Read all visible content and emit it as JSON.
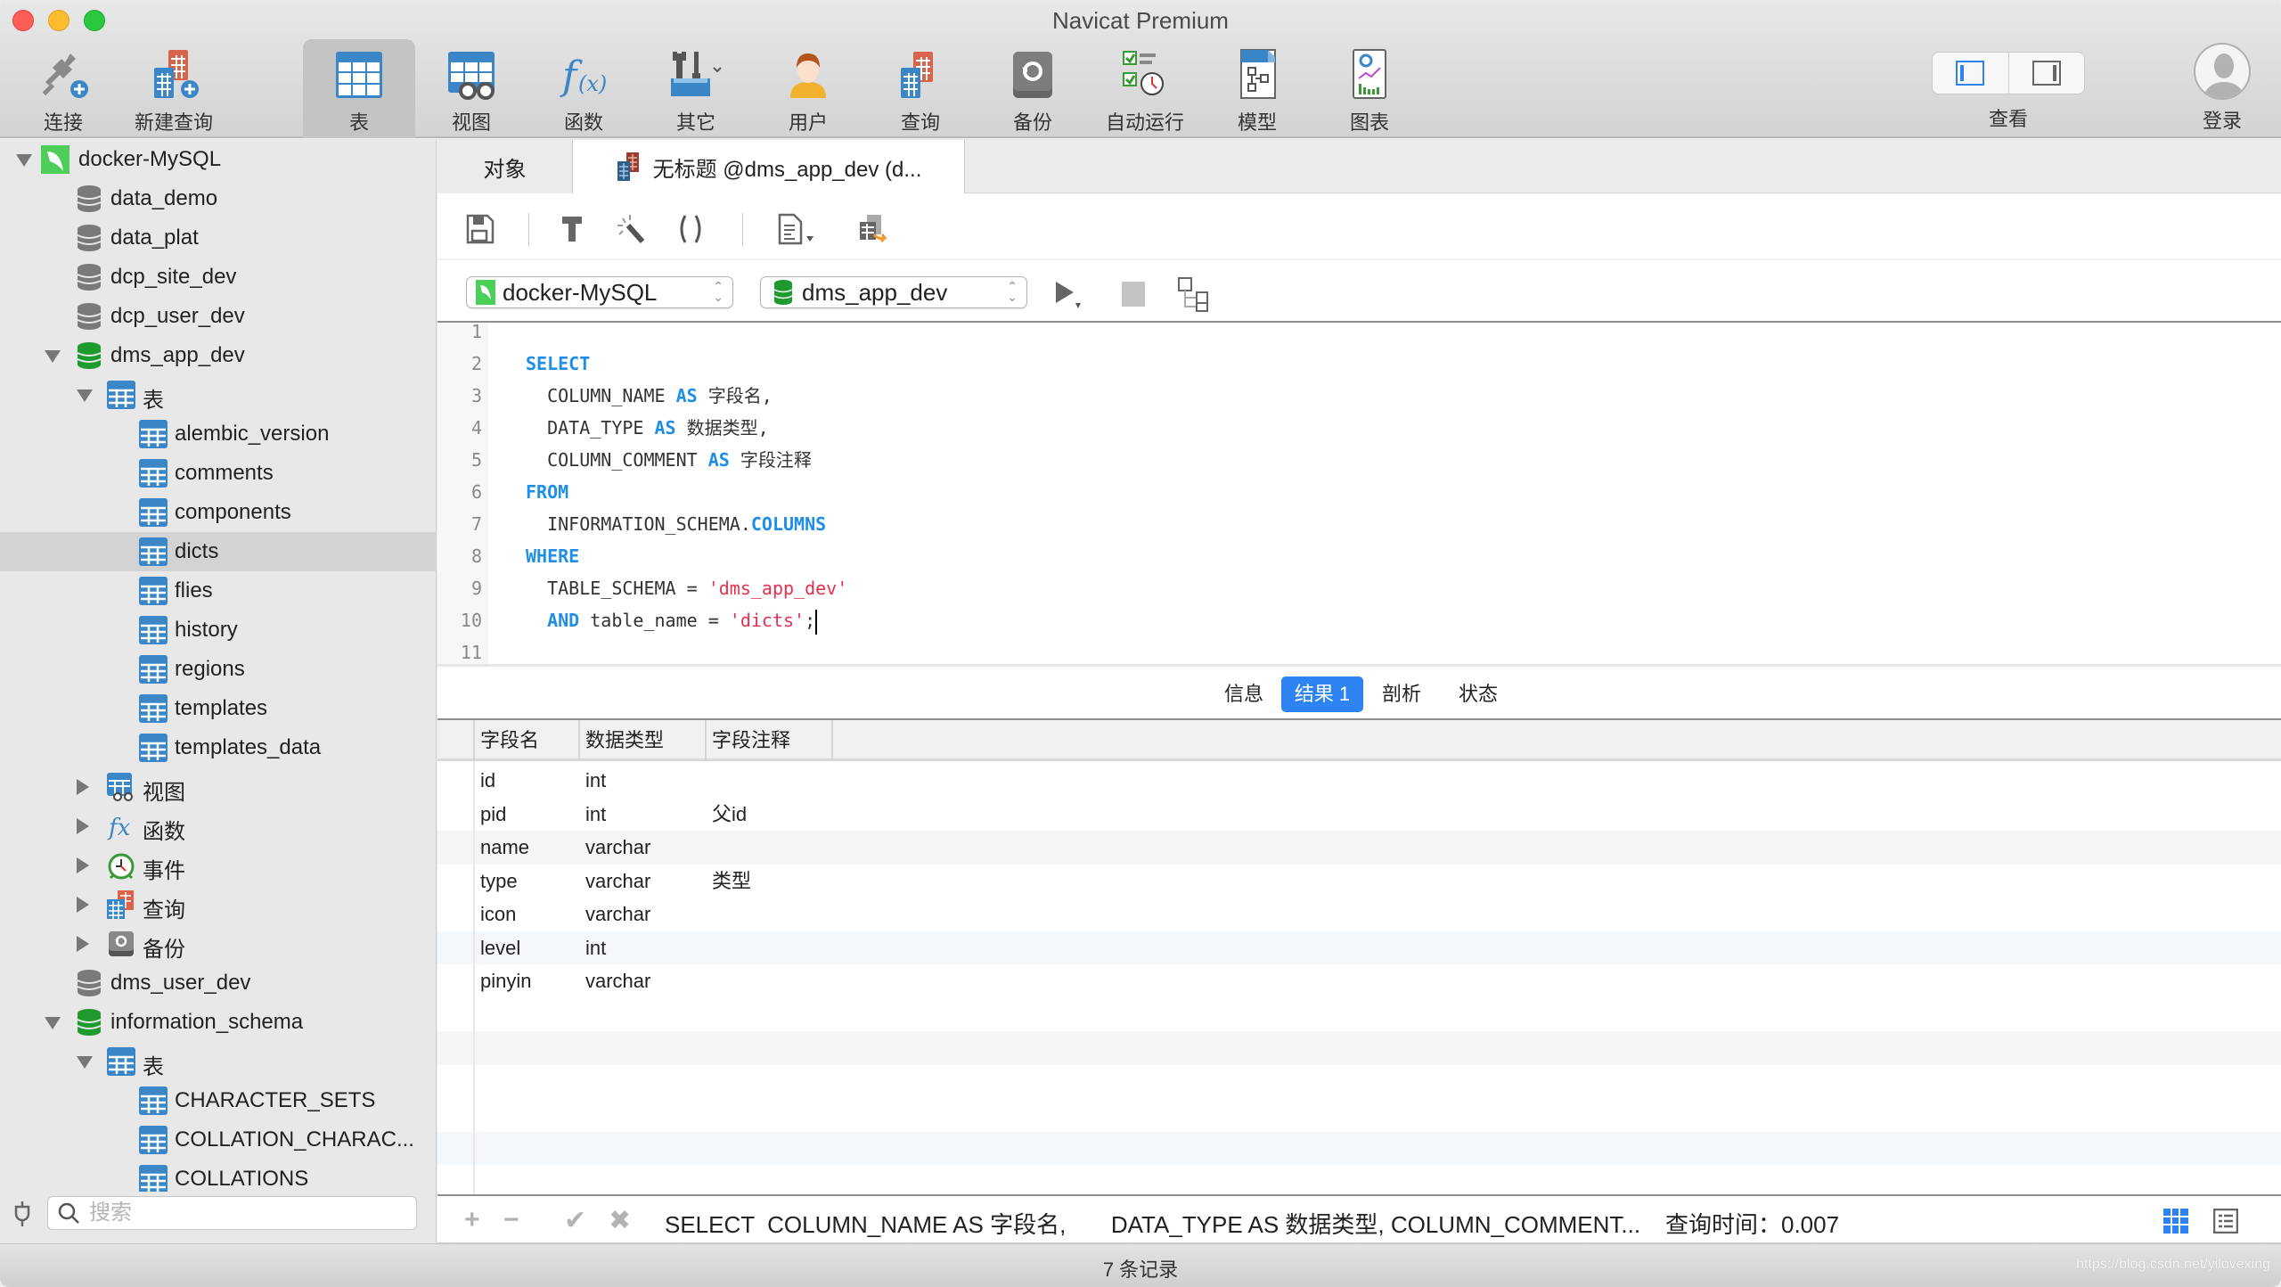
{
  "window": {
    "title": "Navicat Premium"
  },
  "toolbar": {
    "items": [
      {
        "label": "连接",
        "icon": "plug-icon"
      },
      {
        "label": "新建查询",
        "icon": "new-query-icon"
      },
      {
        "label": "表",
        "icon": "table-icon",
        "active": true
      },
      {
        "label": "视图",
        "icon": "view-icon"
      },
      {
        "label": "函数",
        "icon": "function-icon"
      },
      {
        "label": "其它",
        "icon": "tools-icon"
      },
      {
        "label": "用户",
        "icon": "user-icon"
      },
      {
        "label": "查询",
        "icon": "query-icon"
      },
      {
        "label": "备份",
        "icon": "backup-icon"
      },
      {
        "label": "自动运行",
        "icon": "automation-icon"
      },
      {
        "label": "模型",
        "icon": "model-icon"
      },
      {
        "label": "图表",
        "icon": "chart-icon"
      }
    ],
    "view_label": "查看",
    "login_label": "登录"
  },
  "sidebar": {
    "tree": [
      {
        "label": "docker-MySQL",
        "type": "connection",
        "level": 0,
        "expanded": true
      },
      {
        "label": "data_demo",
        "type": "db",
        "level": 1
      },
      {
        "label": "data_plat",
        "type": "db",
        "level": 1
      },
      {
        "label": "dcp_site_dev",
        "type": "db",
        "level": 1
      },
      {
        "label": "dcp_user_dev",
        "type": "db",
        "level": 1
      },
      {
        "label": "dms_app_dev",
        "type": "db-open",
        "level": 1,
        "expanded": true
      },
      {
        "label": "表",
        "type": "tables",
        "level": 2,
        "expanded": true
      },
      {
        "label": "alembic_version",
        "type": "table",
        "level": 3
      },
      {
        "label": "comments",
        "type": "table",
        "level": 3
      },
      {
        "label": "components",
        "type": "table",
        "level": 3
      },
      {
        "label": "dicts",
        "type": "table",
        "level": 3,
        "selected": true
      },
      {
        "label": "flies",
        "type": "table",
        "level": 3
      },
      {
        "label": "history",
        "type": "table",
        "level": 3
      },
      {
        "label": "regions",
        "type": "table",
        "level": 3
      },
      {
        "label": "templates",
        "type": "table",
        "level": 3
      },
      {
        "label": "templates_data",
        "type": "table",
        "level": 3
      },
      {
        "label": "视图",
        "type": "views",
        "level": 2,
        "expanded": false
      },
      {
        "label": "函数",
        "type": "functions",
        "level": 2,
        "expanded": false
      },
      {
        "label": "事件",
        "type": "events",
        "level": 2,
        "expanded": false
      },
      {
        "label": "查询",
        "type": "queries",
        "level": 2,
        "expanded": false
      },
      {
        "label": "备份",
        "type": "backups",
        "level": 2,
        "expanded": false
      },
      {
        "label": "dms_user_dev",
        "type": "db",
        "level": 1
      },
      {
        "label": "information_schema",
        "type": "db-open",
        "level": 1,
        "expanded": true
      },
      {
        "label": "表",
        "type": "tables",
        "level": 2,
        "expanded": true
      },
      {
        "label": "CHARACTER_SETS",
        "type": "table",
        "level": 3
      },
      {
        "label": "COLLATION_CHARAC...",
        "type": "table",
        "level": 3
      },
      {
        "label": "COLLATIONS",
        "type": "table",
        "level": 3
      }
    ],
    "search_placeholder": "搜索"
  },
  "tabs": {
    "objects_label": "对象",
    "query_label": "无标题 @dms_app_dev (d..."
  },
  "connection_bar": {
    "connection": "docker-MySQL",
    "database": "dms_app_dev"
  },
  "editor": {
    "lines": [
      {
        "n": "1",
        "tokens": []
      },
      {
        "n": "2",
        "tokens": [
          {
            "t": "SELECT",
            "c": "kw"
          }
        ]
      },
      {
        "n": "3",
        "tokens": [
          {
            "t": "  COLUMN_NAME ",
            "c": "plain"
          },
          {
            "t": "AS",
            "c": "kw"
          },
          {
            "t": " 字段名,",
            "c": "plain"
          }
        ]
      },
      {
        "n": "4",
        "tokens": [
          {
            "t": "  DATA_TYPE ",
            "c": "plain"
          },
          {
            "t": "AS",
            "c": "kw"
          },
          {
            "t": " 数据类型,",
            "c": "plain"
          }
        ]
      },
      {
        "n": "5",
        "tokens": [
          {
            "t": "  COLUMN_COMMENT ",
            "c": "plain"
          },
          {
            "t": "AS",
            "c": "kw"
          },
          {
            "t": " 字段注释",
            "c": "plain"
          }
        ]
      },
      {
        "n": "6",
        "tokens": [
          {
            "t": "FROM",
            "c": "kw"
          }
        ]
      },
      {
        "n": "7",
        "tokens": [
          {
            "t": "  INFORMATION_SCHEMA.",
            "c": "plain"
          },
          {
            "t": "COLUMNS",
            "c": "kw"
          }
        ]
      },
      {
        "n": "8",
        "tokens": [
          {
            "t": "WHERE",
            "c": "kw"
          }
        ]
      },
      {
        "n": "9",
        "tokens": [
          {
            "t": "  TABLE_SCHEMA = ",
            "c": "plain"
          },
          {
            "t": "'dms_app_dev'",
            "c": "str"
          }
        ]
      },
      {
        "n": "10",
        "tokens": [
          {
            "t": "  ",
            "c": "plain"
          },
          {
            "t": "AND",
            "c": "kw"
          },
          {
            "t": " table_name = ",
            "c": "plain"
          },
          {
            "t": "'dicts'",
            "c": "str"
          },
          {
            "t": ";",
            "c": "plain"
          }
        ],
        "cursor": true
      },
      {
        "n": "11",
        "tokens": []
      }
    ]
  },
  "result_tabs": [
    {
      "label": "信息",
      "active": false
    },
    {
      "label": "结果 1",
      "active": true
    },
    {
      "label": "剖析",
      "active": false
    },
    {
      "label": "状态",
      "active": false
    }
  ],
  "results": {
    "columns": [
      "字段名",
      "数据类型",
      "字段注释"
    ],
    "rows": [
      [
        "id",
        "int",
        ""
      ],
      [
        "pid",
        "int",
        "父id"
      ],
      [
        "name",
        "varchar",
        ""
      ],
      [
        "type",
        "varchar",
        "类型"
      ],
      [
        "icon",
        "varchar",
        ""
      ],
      [
        "level",
        "int",
        ""
      ],
      [
        "pinyin",
        "varchar",
        ""
      ]
    ]
  },
  "action_bar": {
    "sql_preview": "SELECT  COLUMN_NAME AS 字段名,       DATA_TYPE AS 数据类型, COLUMN_COMMENT...",
    "query_time": "查询时间：0.007"
  },
  "status": {
    "records": "7 条记录",
    "watermark": "https://blog.csdn.net/yilovexing"
  },
  "colors": {
    "accent": "#2e83f2",
    "keyword": "#1e8ee6",
    "string": "#e33152",
    "table_icon": "#3b86c6",
    "db_open": "#1e9a2e",
    "db_closed": "#7a7a7a"
  }
}
